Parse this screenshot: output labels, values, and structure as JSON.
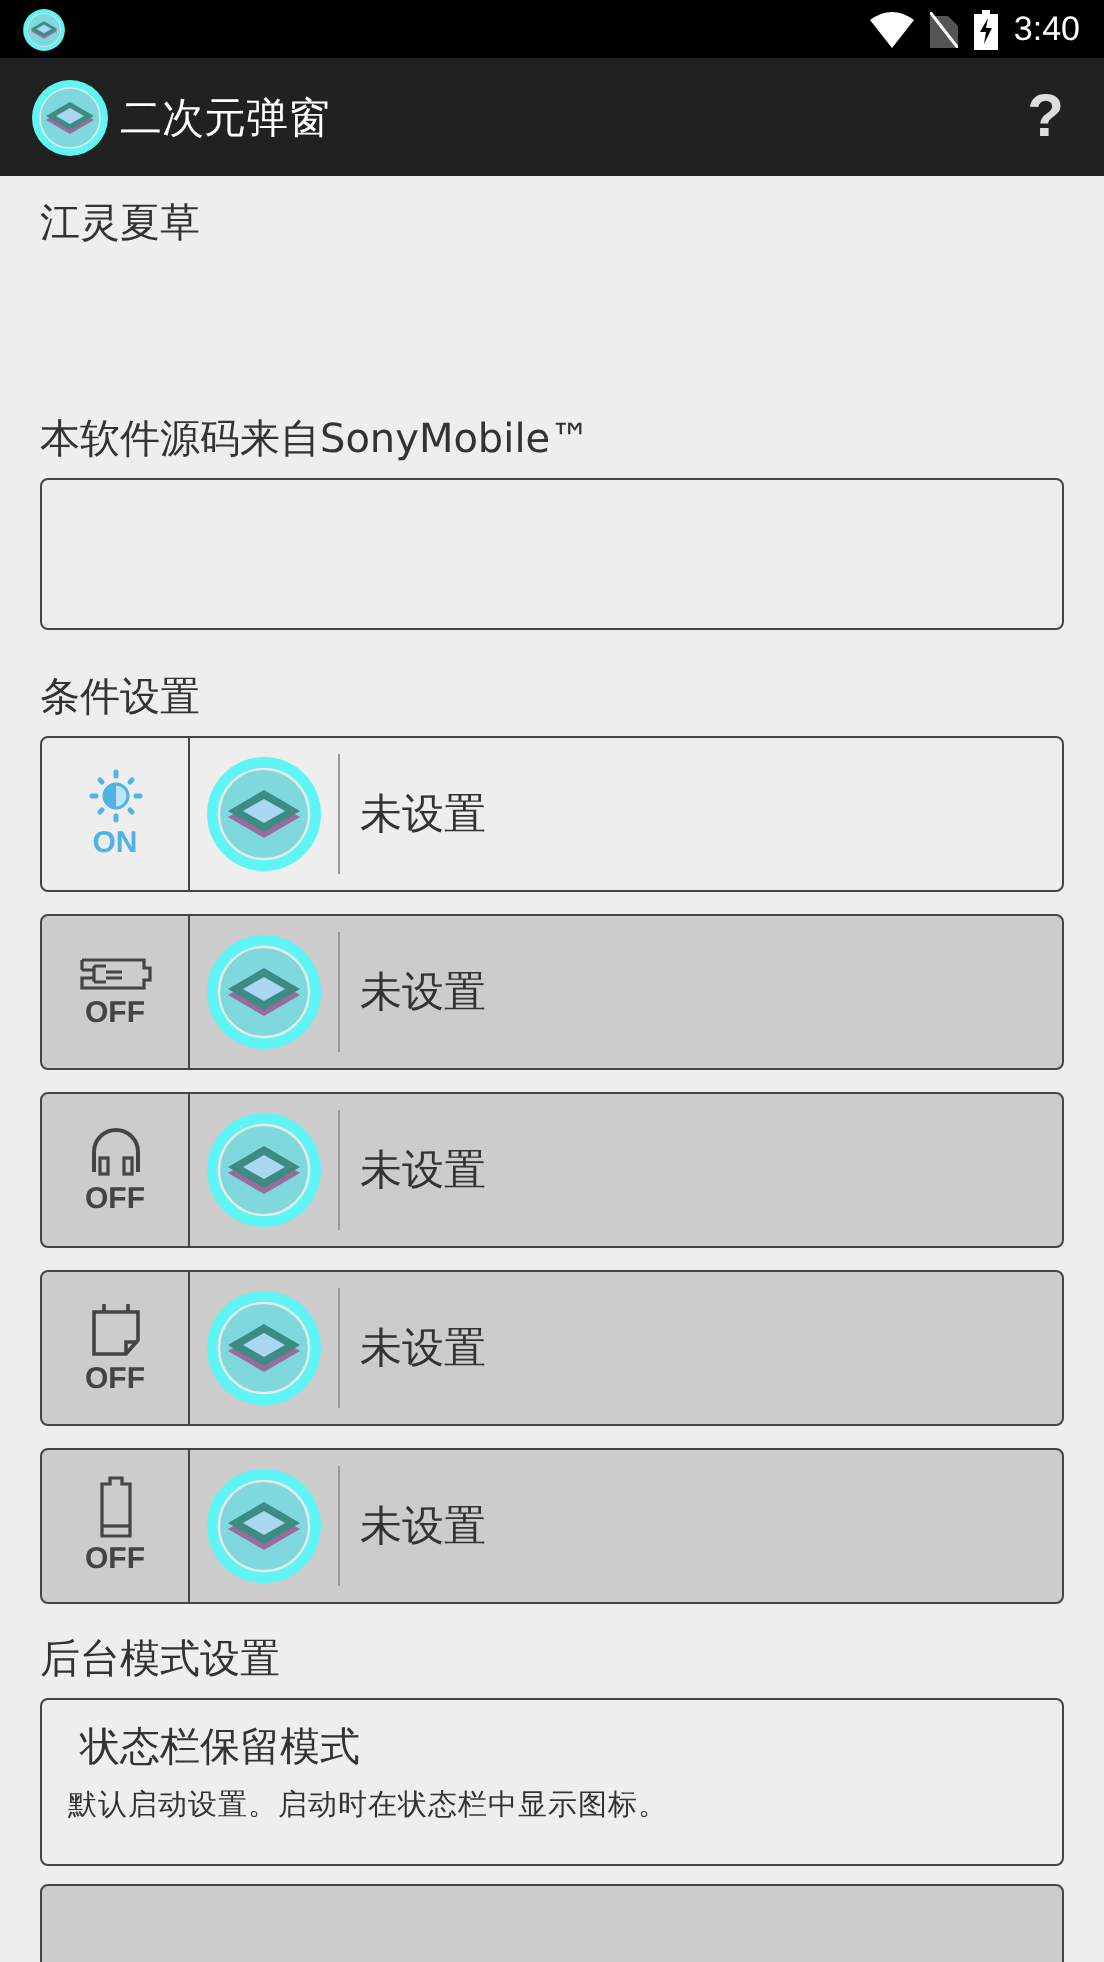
{
  "status_bar": {
    "time": "3:40"
  },
  "app_bar": {
    "title": "二次元弹窗",
    "help": "?"
  },
  "name_label": "江灵夏草",
  "source_label": "本软件源码来自SonyMobile™",
  "conditions": {
    "title": "条件设置",
    "items": [
      {
        "kind": "light",
        "on": true,
        "state": "ON",
        "label": "未设置"
      },
      {
        "kind": "charger",
        "on": false,
        "state": "OFF",
        "label": "未设置"
      },
      {
        "kind": "headphones",
        "on": false,
        "state": "OFF",
        "label": "未设置"
      },
      {
        "kind": "sdcard",
        "on": false,
        "state": "OFF",
        "label": "未设置"
      },
      {
        "kind": "battery",
        "on": false,
        "state": "OFF",
        "label": "未设置"
      }
    ]
  },
  "modes": {
    "title": "后台模式设置",
    "items": [
      {
        "selected": true,
        "title": "状态栏保留模式",
        "description": "默认启动设置。启动时在状态栏中显示图标。"
      },
      {
        "selected": false
      }
    ]
  }
}
